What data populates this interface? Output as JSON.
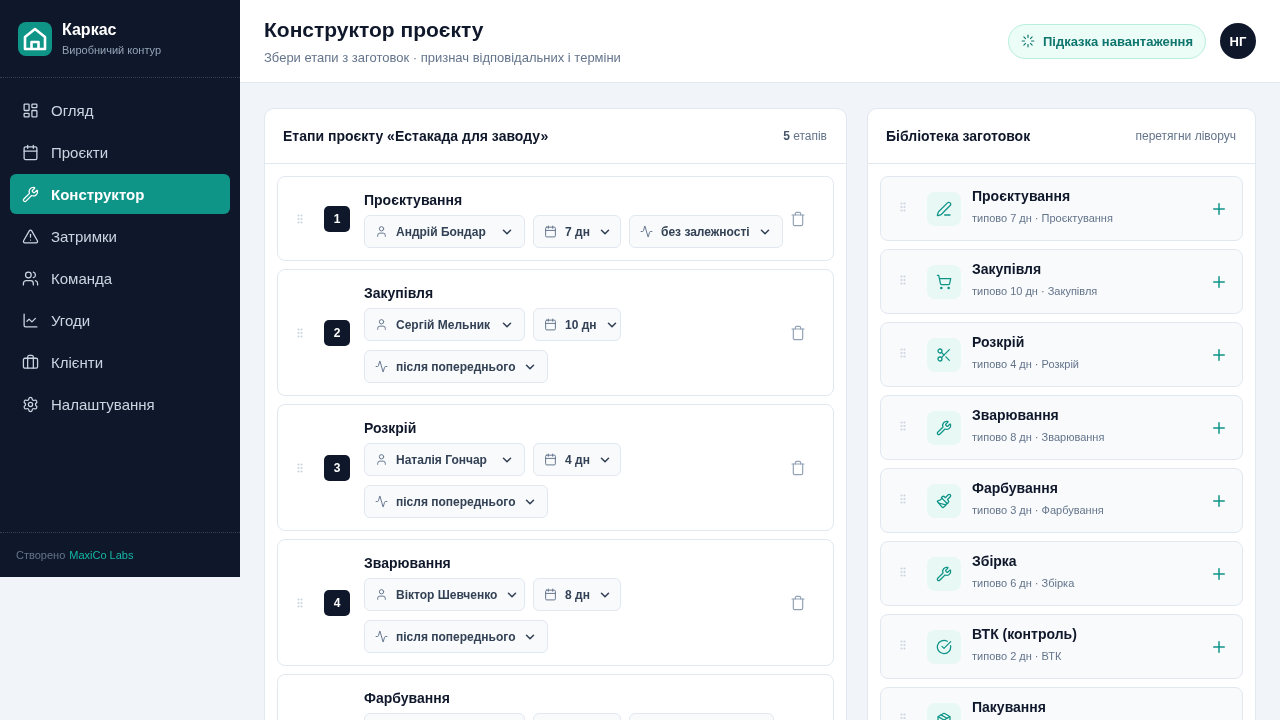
{
  "sidebar": {
    "brand": {
      "name": "Каркас",
      "subtitle": "Виробничий контур"
    },
    "nav": [
      {
        "label": "Огляд",
        "kind": "overview",
        "selected": false
      },
      {
        "label": "Проєкти",
        "kind": "projects",
        "selected": false
      },
      {
        "label": "Конструктор",
        "kind": "builder",
        "selected": true
      },
      {
        "label": "Затримки",
        "kind": "delays",
        "selected": false
      },
      {
        "label": "Команда",
        "kind": "team",
        "selected": false
      },
      {
        "label": "Угоди",
        "kind": "deals",
        "selected": false
      },
      {
        "label": "Клієнти",
        "kind": "clients",
        "selected": false
      },
      {
        "label": "Налаштування",
        "kind": "settings",
        "selected": false
      }
    ],
    "footer": {
      "text": "Створено",
      "link": "MaxiCo Labs"
    }
  },
  "header": {
    "title": "Конструктор проєкту",
    "subtitle": "Збери етапи з заготовок · признач відповідальних і терміни",
    "hint_button": "Підказка навантаження",
    "avatar": "НГ"
  },
  "stages_panel": {
    "title": "Етапи проєкту «Естакада для заводу»",
    "count": "**5** етапів",
    "stages": [
      {
        "number": "1",
        "name": "Проєктування",
        "assignee": "Андрій Бондар",
        "duration": "7 дн",
        "dependency": "без залежності"
      },
      {
        "number": "2",
        "name": "Закупівля",
        "assignee": "Сергій Мельник",
        "duration": "10 дн",
        "dependency": "після попереднього"
      },
      {
        "number": "3",
        "name": "Розкрій",
        "assignee": "Наталія Гончар",
        "duration": "4 дн",
        "dependency": "після попереднього"
      },
      {
        "number": "4",
        "name": "Зварювання",
        "assignee": "Віктор Шевченко",
        "duration": "8 дн",
        "dependency": "після попереднього"
      },
      {
        "name": "Фарбування"
      }
    ]
  },
  "library_panel": {
    "title": "Бібліотека заготовок",
    "hint": "перетягни ліворуч",
    "items": [
      {
        "kind": "design",
        "name": "Проєктування",
        "subtitle": "типово 7 дн · Проєктування"
      },
      {
        "kind": "purchase",
        "name": "Закупівля",
        "subtitle": "типово 10 дн · Закупівля"
      },
      {
        "kind": "cutting",
        "name": "Розкрій",
        "subtitle": "типово 4 дн · Розкрій"
      },
      {
        "kind": "welding",
        "name": "Зварювання",
        "subtitle": "типово 8 дн · Зварювання"
      },
      {
        "kind": "painting",
        "name": "Фарбування",
        "subtitle": "типово 3 дн · Фарбування"
      },
      {
        "kind": "assembly",
        "name": "Збірка",
        "subtitle": "типово 6 дн · Збірка"
      },
      {
        "kind": "quality",
        "name": "ВТК (контроль)",
        "subtitle": "типово 2 дн · ВТК"
      },
      {
        "kind": "packing",
        "name": "Пакування"
      }
    ]
  }
}
